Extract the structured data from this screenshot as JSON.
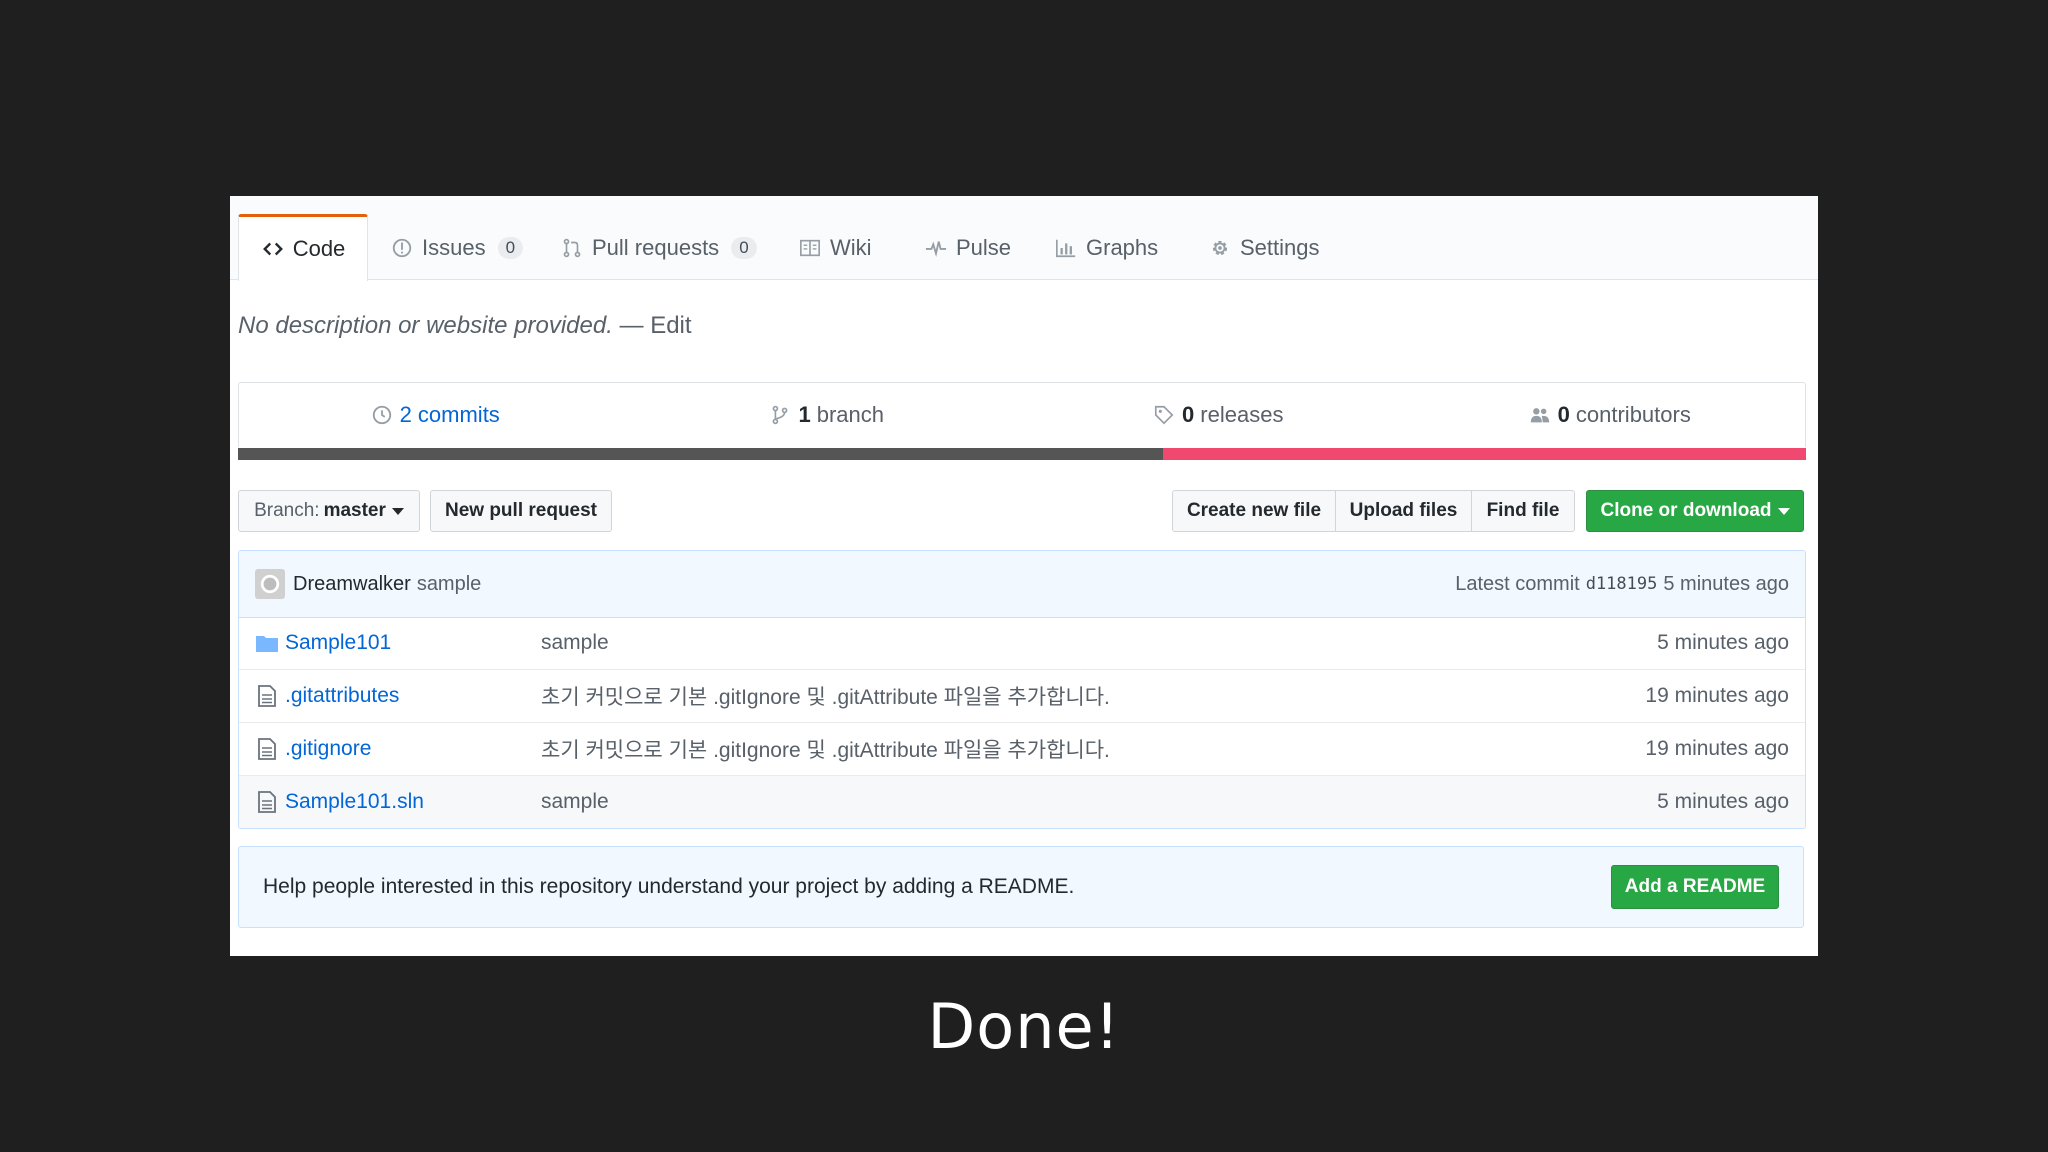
{
  "tabs": [
    {
      "label": "Code",
      "icon": "code-icon"
    },
    {
      "label": "Issues",
      "count": "0",
      "icon": "issue-icon"
    },
    {
      "label": "Pull requests",
      "count": "0",
      "icon": "pull-request-icon"
    },
    {
      "label": "Wiki",
      "icon": "book-icon"
    },
    {
      "label": "Pulse",
      "icon": "pulse-icon"
    },
    {
      "label": "Graphs",
      "icon": "graph-icon"
    },
    {
      "label": "Settings",
      "icon": "gear-icon"
    }
  ],
  "description": {
    "text": "No description or website provided.",
    "separator": "—",
    "edit": "Edit"
  },
  "summary": {
    "commits": {
      "num": "2",
      "label": "commits"
    },
    "branch": {
      "num": "1",
      "label": "branch"
    },
    "releases": {
      "num": "0",
      "label": "releases"
    },
    "contributors": {
      "num": "0",
      "label": "contributors"
    }
  },
  "language_bar": {
    "colors": [
      "#555555",
      "#f1486f"
    ]
  },
  "toolbar": {
    "branch_prefix": "Branch:",
    "branch_name": "master",
    "new_pull_request": "New pull request",
    "create_new_file": "Create new file",
    "upload_files": "Upload files",
    "find_file": "Find file",
    "clone_or_download": "Clone or download"
  },
  "commit_tease": {
    "author": "Dreamwalker",
    "message": "sample",
    "latest_label": "Latest commit",
    "sha": "d118195",
    "age": "5 minutes ago"
  },
  "files": [
    {
      "type": "folder",
      "name": "Sample101",
      "message": "sample",
      "age": "5 minutes ago"
    },
    {
      "type": "file",
      "name": ".gitattributes",
      "message": "초기 커밋으로 기본 .gitIgnore 및 .gitAttribute 파일을 추가합니다.",
      "age": "19 minutes ago"
    },
    {
      "type": "file",
      "name": ".gitignore",
      "message": "초기 커밋으로 기본 .gitIgnore 및 .gitAttribute 파일을 추가합니다.",
      "age": "19 minutes ago"
    },
    {
      "type": "file",
      "name": "Sample101.sln",
      "message": "sample",
      "age": "5 minutes ago"
    }
  ],
  "readme_prompt": {
    "text": "Help people interested in this repository understand your project by adding a README.",
    "button": "Add a README"
  },
  "caption": "Done!",
  "colors": {
    "accent_tab": "#e36209",
    "link": "#0366d6",
    "green": "#28a745",
    "background": "#1f1f20"
  }
}
